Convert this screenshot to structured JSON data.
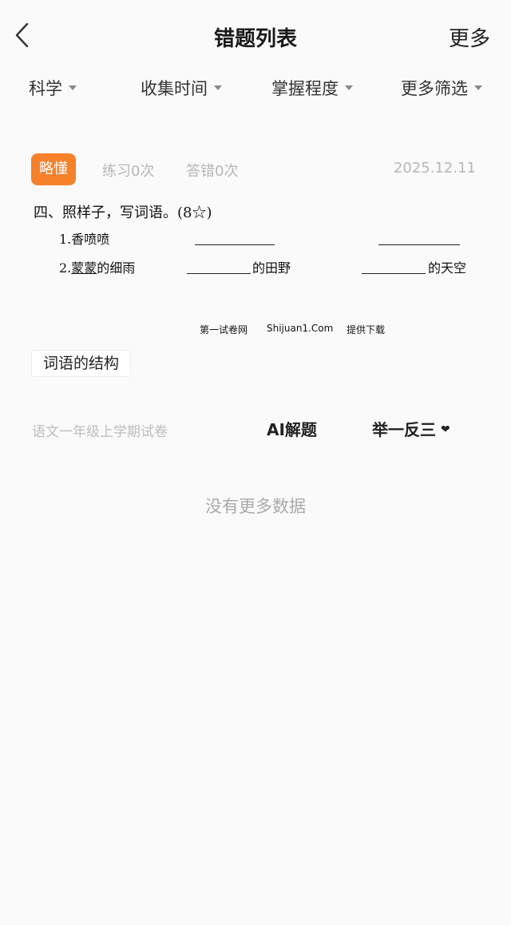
{
  "header": {
    "title": "错题列表",
    "more_label": "更多"
  },
  "filters": [
    {
      "label": "科学"
    },
    {
      "label": "收集时间"
    },
    {
      "label": "掌握程度"
    },
    {
      "label": "更多筛选"
    }
  ],
  "card": {
    "badge": "略懂",
    "badge_color": "#f7802b",
    "practice_count": "练习0次",
    "wrong_count": "答错0次",
    "date": "2025.12.11",
    "question": {
      "heading": "四、照样子，写词语。(8☆)",
      "line1_text": "1.香喷喷",
      "line2_prefix": "2.",
      "line2_underlined": "蒙蒙",
      "line2_rest": "的细雨",
      "suffix_fields": "的田野",
      "suffix_sky": "的天空",
      "watermark_1": "第一试卷网",
      "watermark_2": "Shijuan1.Com",
      "watermark_3": "提供下载"
    },
    "tag": "词语的结构",
    "source": "语文一年级上学期试卷",
    "ai_button": "AI解题",
    "similar_button": "举一反三"
  },
  "no_more_text": "没有更多数据"
}
